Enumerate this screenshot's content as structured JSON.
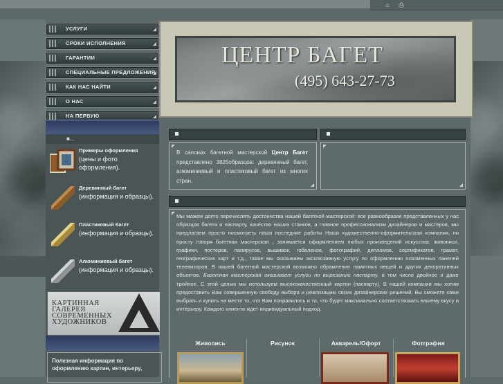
{
  "top_icons": [
    "home-icon",
    "print-icon"
  ],
  "menu": {
    "items": [
      {
        "label": "УСЛУГИ"
      },
      {
        "label": "СРОКИ ИСПОЛНЕНИЯ"
      },
      {
        "label": "ГАРАНТИИ"
      },
      {
        "label": "СПЕЦИАЛЬНЫЕ ПРЕДЛОЖЕНИЯ"
      },
      {
        "label": "КАК НАС НАЙТИ"
      },
      {
        "label": "О НАС"
      },
      {
        "label": "НА ПЕРВУЮ"
      }
    ]
  },
  "banner": {
    "title": "ЦЕНТР БАГЕТ",
    "phone": "(495) 643-27-73"
  },
  "left": {
    "subheader": "■...",
    "cards": [
      {
        "title": "Примеры оформления",
        "subtitle": "(цены и фото оформления)."
      },
      {
        "title": "Деревянный багет",
        "subtitle": "(информация и образцы)."
      },
      {
        "title": "Пластиковый багет",
        "subtitle": "(информация и образцы)."
      },
      {
        "title": "Алюминиевый багет",
        "subtitle": "(информация и образцы)."
      }
    ],
    "gallery": {
      "line1": "КАРТИННАЯ",
      "line2": "ГАЛЕРЕЯ",
      "line3": "СОВРЕМЕННЫХ",
      "line4": "ХУДОЖНИКОВ"
    },
    "useful_text": "Полезная информация по оформлению картин, интерьеру,"
  },
  "intro": {
    "prefix": "В салонах багетной мастерской",
    "brand": "Центр Багет",
    "rest": "представлено 3825образцов: деревянный багет, алюминиевый и пластиковый багет из многих стран."
  },
  "main_text": "Мы можем долго перечислять достоинства нашей багетной мастерской: все разнообразие представленных у нас образцов багета и паспарту, качество наших станков, а главное профессионализм дизайнеров и мастеров, мы предлагаем просто посмотреть наши последние работы Наша художественно-оформительская компания, по просту говоря багетная мастерская , занимается оформлением любых произведений искусства: живописи, графики, постеров, папирусов, вышивок, гобеленов, фотографий, дипломов, сертификатов, грамот, географических карт и т.д., также мы оказываем эксклюзивную услугу по оформлению плазменных панелей телевизоров. В нашей багетной мастерской возможно обрамление памятных вещей и других декоративных объектов.",
  "main_italic": "Багетная мастерская оказывает услуги по вырезанию паспарту,",
  "main_text2": "в том числе двойное и даже тройное. С этой целью мы используем высококачественный картон (паспарту). В нашей компании мы хотим предоставить Вам совершенную свободу выбора и реализацию своих дизайнерских решений. Вы сможете сами выбрать и купить на месте то, что Вам понравилось и то, что будет максимально соответствовать вашему вкусу и интерьеру. Каждого клиента ждет индивидуальный подход.",
  "categories": [
    {
      "label": "Живопись"
    },
    {
      "label": "Рисунок"
    },
    {
      "label": "Акварель/Офорт"
    },
    {
      "label": "Фотграфия"
    }
  ]
}
